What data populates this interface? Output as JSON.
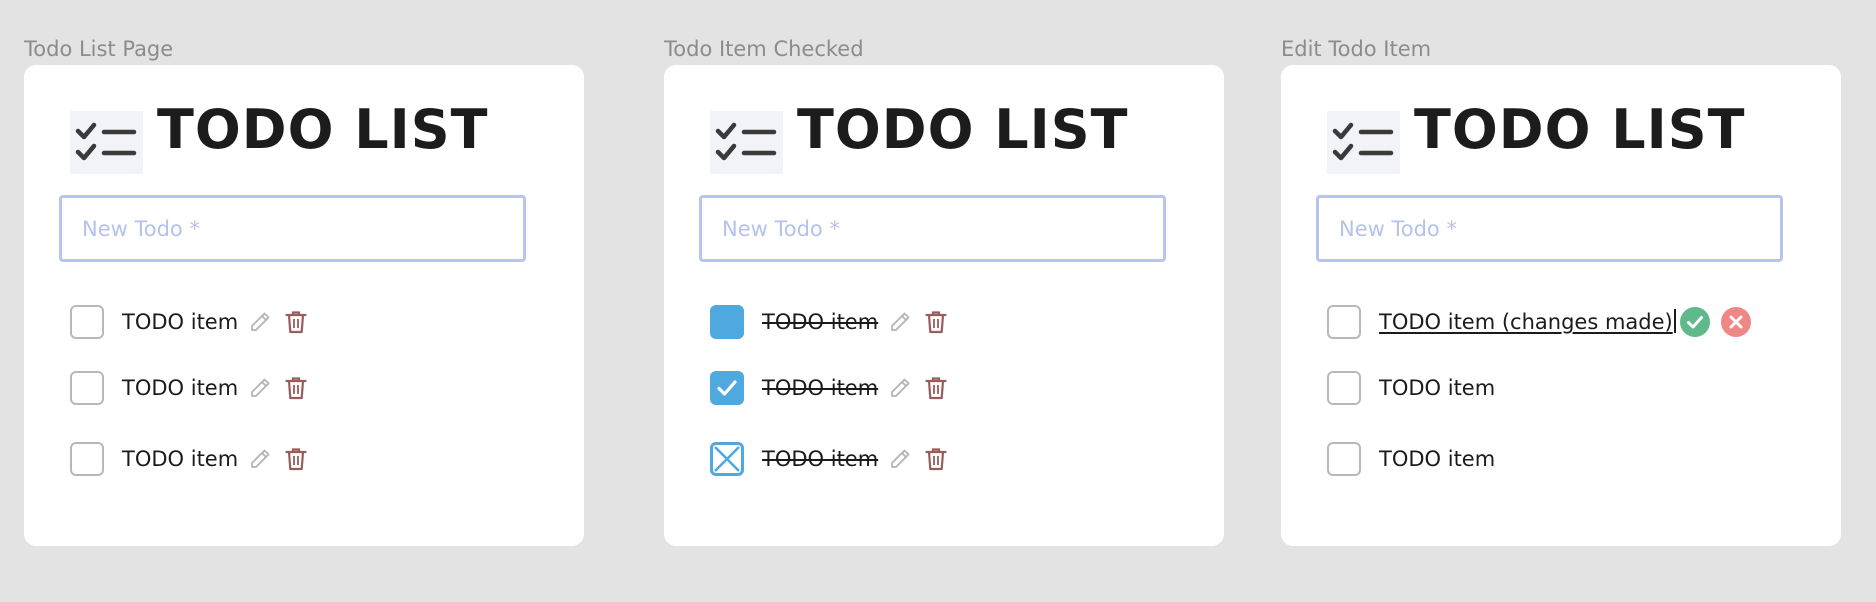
{
  "colors": {
    "background": "#e3e3e3",
    "card": "#ffffff",
    "accent_checkbox": "#4fa8de",
    "input_border": "#b9c4ee",
    "placeholder": "#b7c2ec",
    "trash": "#9b5c5c",
    "pencil": "#b3b3b3",
    "confirm": "#5fb98a",
    "cancel": "#ef8785"
  },
  "frames": [
    {
      "label": "Todo List Page",
      "title": "TODO LIST",
      "input_placeholder": "New Todo *",
      "items": [
        {
          "text": "TODO item",
          "state": "unchecked"
        },
        {
          "text": "TODO item",
          "state": "unchecked"
        },
        {
          "text": "TODO item",
          "state": "unchecked"
        }
      ]
    },
    {
      "label": "Todo Item Checked",
      "title": "TODO LIST",
      "input_placeholder": "New Todo *",
      "items": [
        {
          "text": "TODO item",
          "state": "hover-filled"
        },
        {
          "text": "TODO item",
          "state": "checked"
        },
        {
          "text": "TODO item",
          "state": "crossed"
        }
      ]
    },
    {
      "label": "Edit Todo Item",
      "title": "TODO LIST",
      "input_placeholder": "New Todo *",
      "items": [
        {
          "text": "TODO item (changes made)",
          "state": "editing"
        },
        {
          "text": "TODO item",
          "state": "unchecked"
        },
        {
          "text": "TODO item",
          "state": "unchecked"
        }
      ]
    }
  ],
  "icons": {
    "logo": "checklist-icon",
    "edit": "pencil-icon",
    "delete": "trash-icon",
    "save": "check-circle-icon",
    "cancel": "x-circle-icon"
  }
}
